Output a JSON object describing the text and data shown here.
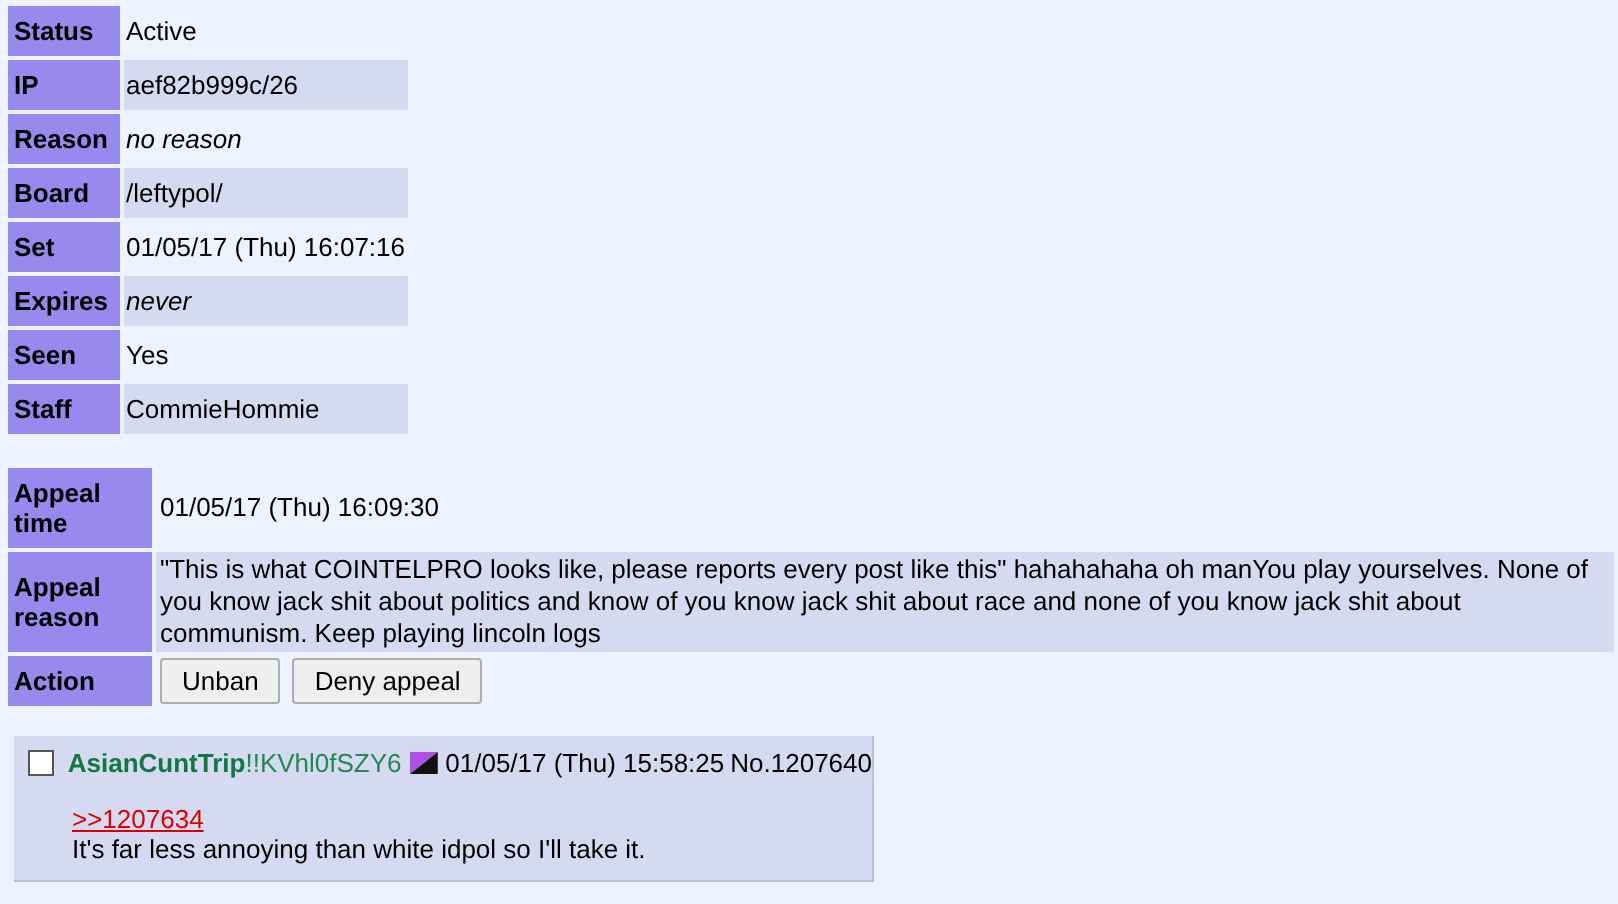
{
  "ban": [
    {
      "label": "Status",
      "value": "Active",
      "italic": false
    },
    {
      "label": "IP",
      "value": "aef82b999c/26",
      "italic": false
    },
    {
      "label": "Reason",
      "value": "no reason",
      "italic": true
    },
    {
      "label": "Board",
      "value": "/leftypol/",
      "italic": false
    },
    {
      "label": "Set",
      "value": "01/05/17 (Thu) 16:07:16",
      "italic": false
    },
    {
      "label": "Expires",
      "value": "never",
      "italic": true
    },
    {
      "label": "Seen",
      "value": "Yes",
      "italic": false
    },
    {
      "label": "Staff",
      "value": "CommieHommie",
      "italic": false
    }
  ],
  "appeal": {
    "time_label": "Appeal time",
    "time": "01/05/17 (Thu) 16:09:30",
    "reason_label": "Appeal reason",
    "reason": "\"This is what COINTELPRO looks like, please reports every post like this\" hahahahaha oh manYou play yourselves. None of you know jack shit about politics and know of you know jack shit about race and none of you know jack shit about communism. Keep playing lincoln logs",
    "action_label": "Action",
    "buttons": [
      "Unban",
      "Deny appeal"
    ]
  },
  "post": {
    "checked": false,
    "name": "AsianCuntTrip",
    "trip": "!!KVhl0fSZY6",
    "date": "01/05/17 (Thu) 15:58:25",
    "number_label": "No.",
    "number": "1207640",
    "reply_link": ">>1207634",
    "body": "It's far less annoying than white idpol so I'll take it."
  }
}
